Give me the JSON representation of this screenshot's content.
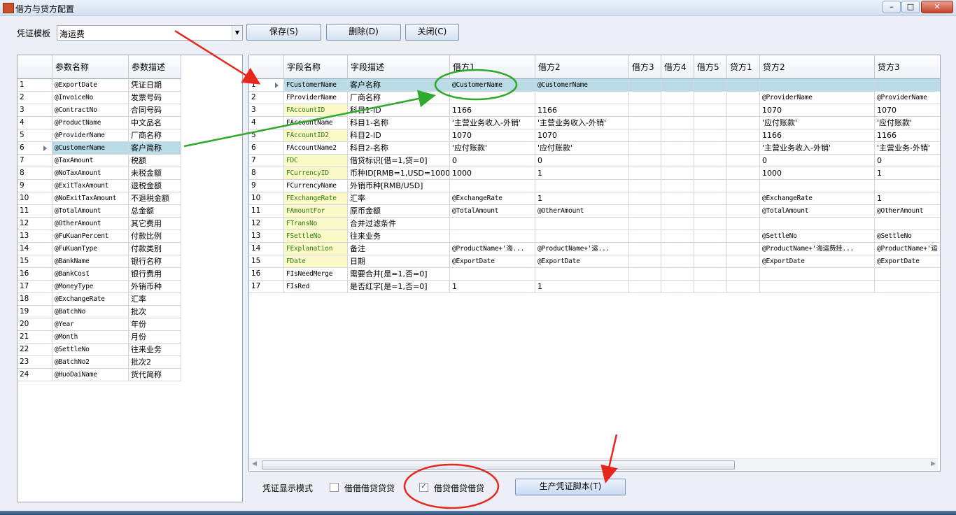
{
  "window": {
    "title": "借方与贷方配置"
  },
  "toolbar": {
    "template_label": "凭证模板",
    "template_value": "海运费",
    "save_label": "保存(S)",
    "delete_label": "删除(D)",
    "close_label": "关闭(C)"
  },
  "params": {
    "headers": [
      "参数名称",
      "参数描述"
    ],
    "rows": [
      [
        "1",
        "@ExportDate",
        "凭证日期"
      ],
      [
        "2",
        "@InvoiceNo",
        "发票号码"
      ],
      [
        "3",
        "@ContractNo",
        "合同号码"
      ],
      [
        "4",
        "@ProductName",
        "中文品名"
      ],
      [
        "5",
        "@ProviderName",
        "厂商名称"
      ],
      [
        "6",
        "@CustomerName",
        "客户简称"
      ],
      [
        "7",
        "@TaxAmount",
        "税额"
      ],
      [
        "8",
        "@NoTaxAmount",
        "未税金额"
      ],
      [
        "9",
        "@ExitTaxAmount",
        "退税金额"
      ],
      [
        "10",
        "@NoExitTaxAmount",
        "不退税金额"
      ],
      [
        "11",
        "@TotalAmount",
        "总金额"
      ],
      [
        "12",
        "@OtherAmount",
        "其它费用"
      ],
      [
        "13",
        "@FuKuanPercent",
        "付款比例"
      ],
      [
        "14",
        "@FuKuanType",
        "付款类别"
      ],
      [
        "15",
        "@BankName",
        "银行名称"
      ],
      [
        "16",
        "@BankCost",
        "银行费用"
      ],
      [
        "17",
        "@MoneyType",
        "外销币种"
      ],
      [
        "18",
        "@ExchangeRate",
        "汇率"
      ],
      [
        "19",
        "@BatchNo",
        "批次"
      ],
      [
        "20",
        "@Year",
        "年份"
      ],
      [
        "21",
        "@Month",
        "月份"
      ],
      [
        "22",
        "@SettleNo",
        "往来业务"
      ],
      [
        "23",
        "@BatchNo2",
        "批次2"
      ],
      [
        "24",
        "@HuoDaiName",
        "货代简称"
      ]
    ]
  },
  "fields": {
    "headers": [
      "字段名称",
      "字段描述",
      "借方1",
      "借方2",
      "借方3",
      "借方4",
      "借方5",
      "贷方1",
      "贷方2",
      "贷方3"
    ],
    "rows": [
      [
        "1",
        "FCustomerName",
        "客户名称",
        "@CustomerName",
        "@CustomerName",
        "",
        "",
        "",
        "",
        "",
        ""
      ],
      [
        "2",
        "FProviderName",
        "厂商名称",
        "",
        "",
        "",
        "",
        "",
        "",
        "@ProviderName",
        "@ProviderName"
      ],
      [
        "3",
        "FAccountID",
        "科目1-ID",
        "1166",
        "1166",
        "",
        "",
        "",
        "",
        "1070",
        "1070"
      ],
      [
        "4",
        "FAccountName",
        "科目1-名称",
        "'主营业务收入-外销'",
        "'主营业务收入-外销'",
        "",
        "",
        "",
        "",
        "'应付账款'",
        "'应付账款'"
      ],
      [
        "5",
        "FAccountID2",
        "科目2-ID",
        "1070",
        "1070",
        "",
        "",
        "",
        "",
        "1166",
        "1166"
      ],
      [
        "6",
        "FAccountName2",
        "科目2-名称",
        "'应付账款'",
        "'应付账款'",
        "",
        "",
        "",
        "",
        "'主营业务收入-外销'",
        "'主营业务-外销'"
      ],
      [
        "7",
        "FDC",
        "借贷标识[借=1,贷=0]",
        "0",
        "0",
        "",
        "",
        "",
        "",
        "0",
        "0"
      ],
      [
        "8",
        "FCurrencyID",
        "币种ID[RMB=1,USD=1000]",
        "1000",
        "1",
        "",
        "",
        "",
        "",
        "1000",
        "1"
      ],
      [
        "9",
        "FCurrencyName",
        "外销币种[RMB/USD]",
        "",
        "",
        "",
        "",
        "",
        "",
        "",
        ""
      ],
      [
        "10",
        "FExchangeRate",
        "汇率",
        "@ExchangeRate",
        "1",
        "",
        "",
        "",
        "",
        "@ExchangeRate",
        "1"
      ],
      [
        "11",
        "FAmountFor",
        "原币金额",
        "@TotalAmount",
        "@OtherAmount",
        "",
        "",
        "",
        "",
        "@TotalAmount",
        "@OtherAmount"
      ],
      [
        "12",
        "FTransNo",
        "合并过滤条件",
        "",
        "",
        "",
        "",
        "",
        "",
        "",
        ""
      ],
      [
        "13",
        "FSettleNo",
        "往来业务",
        "",
        "",
        "",
        "",
        "",
        "",
        "@SettleNo",
        "@SettleNo"
      ],
      [
        "14",
        "FExplanation",
        "备注",
        "@ProductName+'海...",
        "@ProductName+'运...",
        "",
        "",
        "",
        "",
        "@ProductName+'海运费挂...",
        "@ProductName+'运"
      ],
      [
        "15",
        "FDate",
        "日期",
        "@ExportDate",
        "@ExportDate",
        "",
        "",
        "",
        "",
        "@ExportDate",
        "@ExportDate"
      ],
      [
        "16",
        "FIsNeedMerge",
        "需要合并[是=1,否=0]",
        "",
        "",
        "",
        "",
        "",
        "",
        "",
        ""
      ],
      [
        "17",
        "FIsRed",
        "是否红字[是=1,否=0]",
        "1",
        "1",
        "",
        "",
        "",
        "",
        "",
        ""
      ]
    ]
  },
  "footer": {
    "mode_label": "凭证显示模式",
    "option1_label": "借借借贷贷贷",
    "option1_checked": false,
    "option2_label": "借贷借贷借贷",
    "option2_checked": true,
    "generate_label": "生产凭证脚本(T)"
  },
  "colors": {
    "selected_row": "#b8dbe6",
    "highlight_field": "#fbf9c8",
    "annotation_red": "#e8261c",
    "annotation_green": "#2faa2a"
  }
}
